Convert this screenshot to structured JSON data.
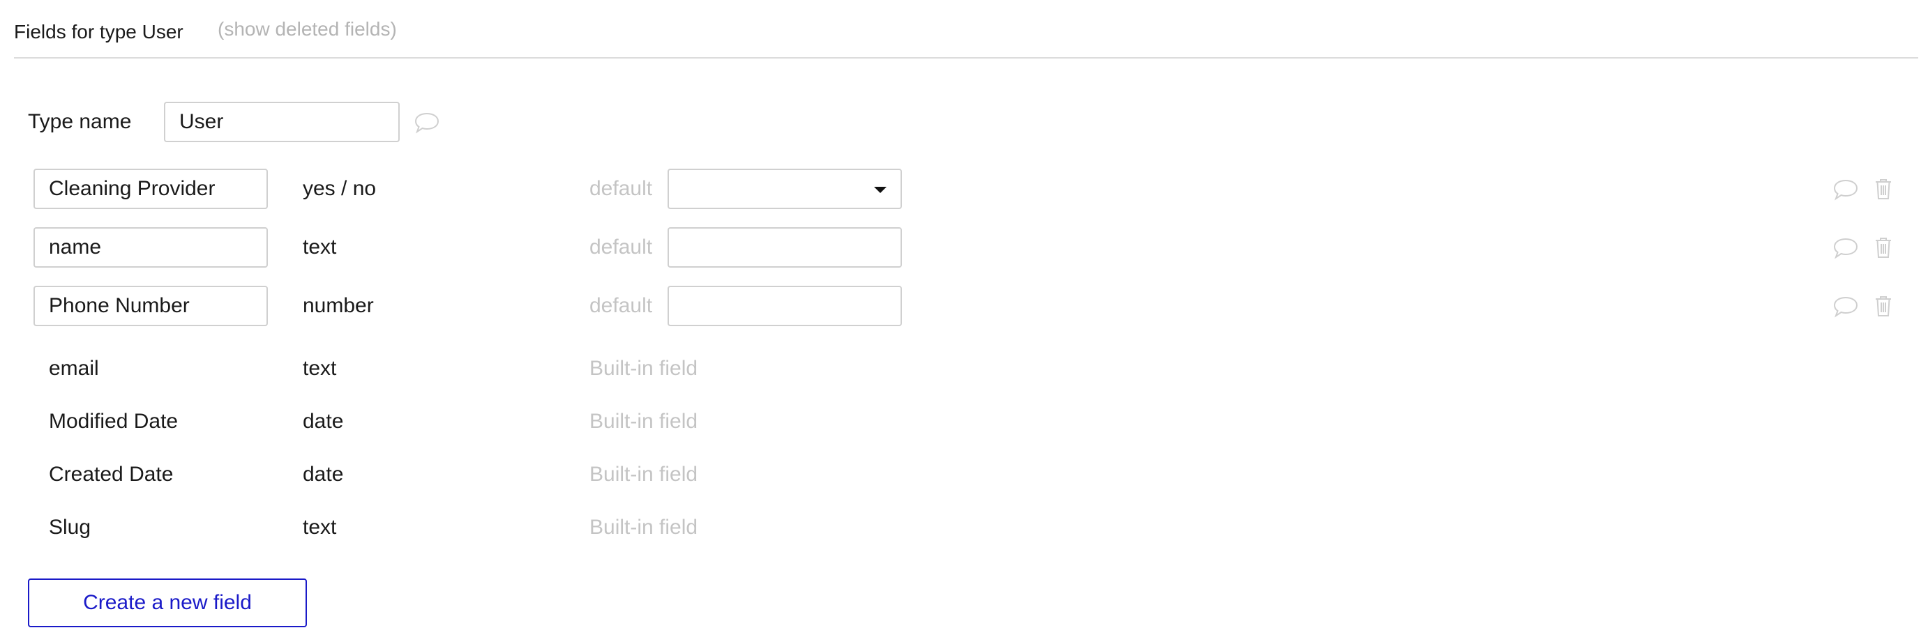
{
  "header": {
    "title": "Fields for type User",
    "show_deleted_label": "(show deleted fields)"
  },
  "type_name": {
    "label": "Type name",
    "value": "User"
  },
  "default_label": "default",
  "builtin_label": "Built-in field",
  "editable_fields": [
    {
      "name": "Cleaning Provider",
      "type": "yes / no",
      "default_control": "dropdown",
      "default_value": ""
    },
    {
      "name": "name",
      "type": "text",
      "default_control": "input",
      "default_value": ""
    },
    {
      "name": "Phone Number",
      "type": "number",
      "default_control": "input",
      "default_value": ""
    }
  ],
  "builtin_fields": [
    {
      "name": "email",
      "type": "text"
    },
    {
      "name": "Modified Date",
      "type": "date"
    },
    {
      "name": "Created Date",
      "type": "date"
    },
    {
      "name": "Slug",
      "type": "text"
    }
  ],
  "create_button_label": "Create a new field",
  "colors": {
    "accent": "#1a1ac8",
    "muted_text": "#c4c4c4",
    "border": "#d0d0d0",
    "icon": "#cfcfcf"
  },
  "icons": {
    "comment": "speech-bubble-icon",
    "delete": "trash-icon",
    "dropdown": "caret-down-icon"
  }
}
